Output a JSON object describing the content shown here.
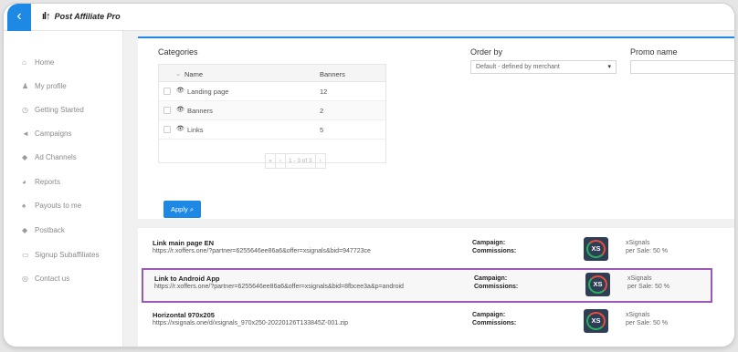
{
  "app": {
    "logo_text": "Post Affiliate Pro",
    "back_icon": "back-arrow-icon"
  },
  "sidebar": {
    "items": [
      {
        "label": "Home",
        "icon": "home-icon"
      },
      {
        "label": "My profile",
        "icon": "person-icon"
      },
      {
        "label": "Getting Started",
        "icon": "clock-icon"
      },
      {
        "label": "Campaigns",
        "icon": "megaphone-icon"
      },
      {
        "label": "Ad Channels",
        "icon": "channel-icon"
      },
      {
        "label": "Reports",
        "icon": "chart-icon"
      },
      {
        "label": "Payouts to me",
        "icon": "money-bag-icon"
      },
      {
        "label": "Postback",
        "icon": "postback-icon"
      },
      {
        "label": "Signup Subaffiliates",
        "icon": "monitor-icon"
      },
      {
        "label": "Contact us",
        "icon": "contact-icon"
      }
    ]
  },
  "filters": {
    "categories_label": "Categories",
    "order_by_label": "Order by",
    "promo_name_label": "Promo name",
    "order_by_value": "Default - defined by merchant",
    "promo_name_value": "",
    "apply_label": "Apply"
  },
  "categories_table": {
    "columns": [
      "Name",
      "Banners"
    ],
    "rows": [
      {
        "name": "Landing page",
        "banners": "12"
      },
      {
        "name": "Banners",
        "banners": "2"
      },
      {
        "name": "Links",
        "banners": "5"
      }
    ],
    "pager": {
      "first": "«",
      "prev": "‹",
      "info": "1 - 3 of 3",
      "next": "›"
    }
  },
  "links": [
    {
      "title": "Link main page EN",
      "url": "https://r.xoffers.one/?partner=6255646ee86a6&offer=xsignals&bid=947723ce",
      "campaign_label": "Campaign:",
      "commissions_label": "Commissions:",
      "campaign": "xSignals",
      "commission": "per Sale: 50 %",
      "logo_text": "XS"
    },
    {
      "title": "Link to Android App",
      "url": "https://r.xoffers.one/?partner=6255646ee86a6&offer=xsignals&bid=8fbcee3a&p=android",
      "campaign_label": "Campaign:",
      "commissions_label": "Commissions:",
      "campaign": "xSignals",
      "commission": "per Sale: 50 %",
      "logo_text": "XS",
      "highlighted": true,
      "highlight_color": "#9b59b6"
    },
    {
      "title": "Horizontal 970x205",
      "url": "https://xsignals.one/d/xsignals_970x250-20220126T133845Z-001.zip",
      "campaign_label": "Campaign:",
      "commissions_label": "Commissions:",
      "campaign": "xSignals",
      "commission": "per Sale: 50 %",
      "logo_text": "XS"
    }
  ],
  "colors": {
    "accent": "#1e88e5",
    "highlight": "#9b59b6"
  }
}
